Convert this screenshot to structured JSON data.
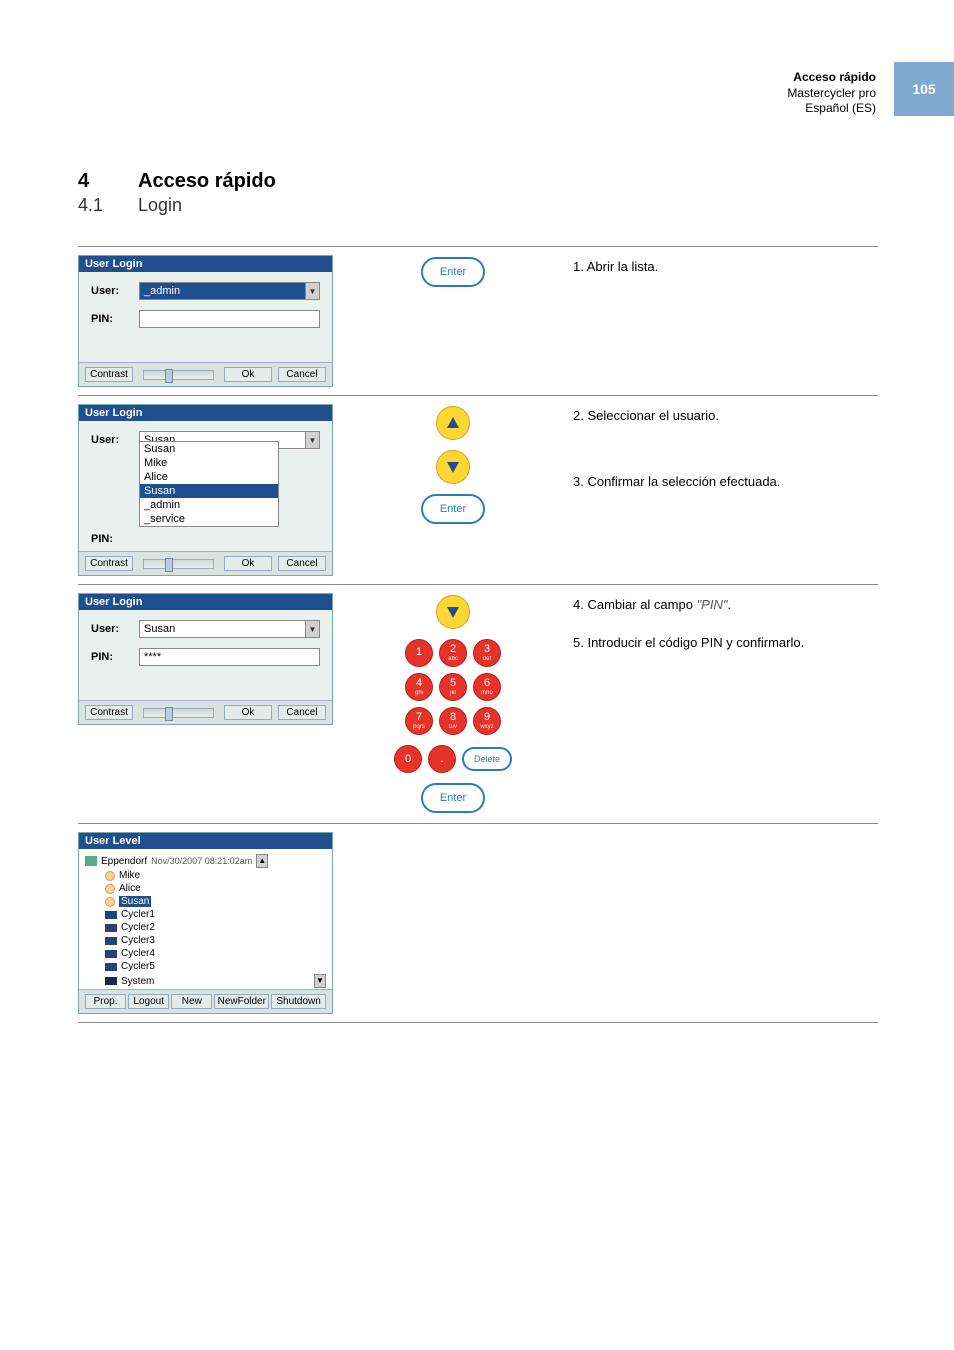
{
  "header": {
    "title_bold": "Acceso rápido",
    "product": "Mastercycler pro",
    "lang": "Español (ES)",
    "page_number": "105"
  },
  "section": {
    "num": "4",
    "title": "Acceso rápido",
    "sub_num": "4.1",
    "sub_title": "Login"
  },
  "keys": {
    "enter": "Enter",
    "delete": "Delete",
    "digits": [
      "1",
      "2",
      "3",
      "4",
      "5",
      "6",
      "7",
      "8",
      "9",
      "0",
      "."
    ],
    "subs": [
      "",
      "abc",
      "def",
      "ghi",
      "jkl",
      "mno",
      "pqrs",
      "tuv",
      "wxyz",
      "",
      ""
    ]
  },
  "steps": {
    "s1": "1. Abrir la lista.",
    "s2": "2. Seleccionar el usuario.",
    "s3": "3. Confirmar la selección efectuada.",
    "s4a": "4. Cambiar al campo ",
    "s4b": "\"PIN\"",
    "s4c": ".",
    "s5": "5. Introducir el código PIN y confirmarlo."
  },
  "dlg": {
    "title_login": "User Login",
    "title_tree": "User Level",
    "label_user": "User:",
    "label_pin": "PIN:",
    "admin": "_admin",
    "user_susan": "Susan",
    "pin_mask": "****",
    "list": [
      "Susan",
      "Mike",
      "Alice",
      "Susan",
      "_admin",
      "_service"
    ],
    "btn_contrast": "Contrast",
    "btn_ok": "Ok",
    "btn_cancel": "Cancel",
    "tree_root": "Eppendorf",
    "tree_ts": "Nov/30/2007 08:21:02am",
    "tree_users": [
      "Mike",
      "Alice",
      "Susan"
    ],
    "tree_cyclers": [
      "Cycler1",
      "Cycler2",
      "Cycler3",
      "Cycler4",
      "Cycler5"
    ],
    "tree_system": "System",
    "tree_btns": [
      "Prop.",
      "Logout",
      "New",
      "NewFolder",
      "Shutdown"
    ]
  }
}
